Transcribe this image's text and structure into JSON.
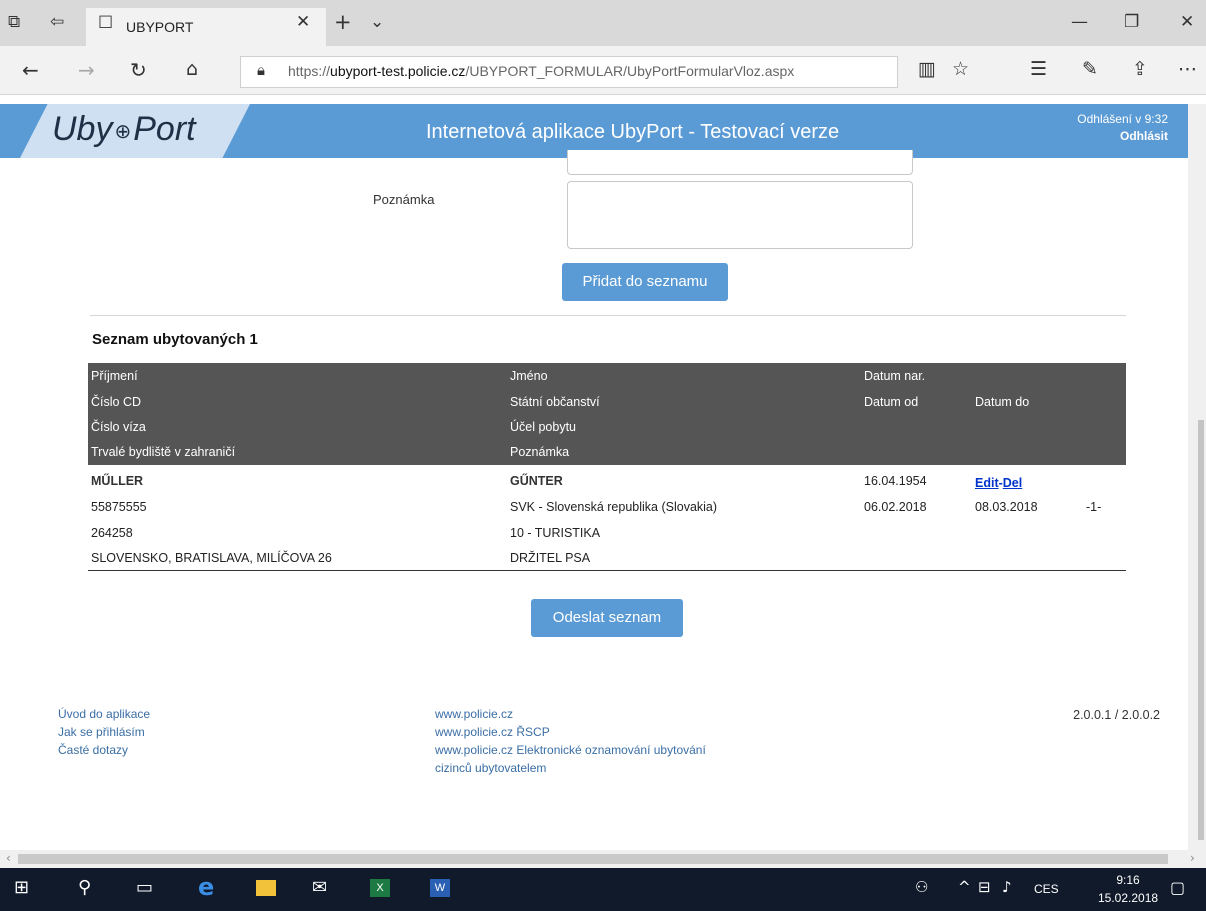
{
  "browser": {
    "tab_title": "UBYPORT",
    "url_prefix": "https://",
    "url_host": "ubyport-test.policie.cz",
    "url_path": "/UBYPORT_FORMULAR/UbyPortFormularVloz.aspx"
  },
  "header": {
    "logo_left": "Uby",
    "logo_right": "Port",
    "title": "Internetová aplikace UbyPort - Testovací verze",
    "logout_info": "Odhlášení v 9:32",
    "logout_link": "Odhlásit"
  },
  "form": {
    "note_label": "Poznámka",
    "note_value": "",
    "add_button": "Přidat do seznamu"
  },
  "list": {
    "title": "Seznam ubytovaných 1",
    "headers": {
      "col1": [
        "Příjmení",
        "Číslo CD",
        "Číslo víza",
        "Trvalé bydliště v zahraničí"
      ],
      "col2": [
        "Jméno",
        "Státní občanství",
        "Účel pobytu",
        "Poznámka"
      ],
      "col3": [
        "Datum nar.",
        "Datum od"
      ],
      "col4": [
        "Datum do"
      ]
    },
    "row": {
      "surname": "MŰLLER",
      "cd_number": "55875555",
      "visa_number": "264258",
      "address": "SLOVENSKO, BRATISLAVA, MILÍČOVA 26",
      "name": "GŰNTER",
      "citizenship": "SVK - Slovenská republika (Slovakia)",
      "purpose": "10 - TURISTIKA",
      "note": "DRŽITEL PSA",
      "birth_date": "16.04.1954",
      "date_from": "06.02.2018",
      "date_to": "08.03.2018",
      "edit": "Edit",
      "separator": "-",
      "del": "Del",
      "index": "-1-"
    },
    "send_button": "Odeslat seznam"
  },
  "footer": {
    "left_links": [
      "Úvod do aplikace",
      "Jak se přihlásím",
      "Časté dotazy"
    ],
    "mid_links": [
      "www.policie.cz",
      "www.policie.cz ŘSCP",
      "www.policie.cz Elektronické oznamování ubytování",
      "cizinců ubytovatelem"
    ],
    "version": "2.0.0.1 / 2.0.0.2"
  },
  "taskbar": {
    "language": "CES",
    "time": "9:16",
    "date": "15.02.2018"
  },
  "icons": {
    "browser": [
      "tab-preview-icon",
      "set-aside-tabs-icon",
      "tab-page-icon",
      "close-tab-icon",
      "new-tab-icon",
      "tab-dropdown-icon",
      "minimize-icon",
      "restore-icon",
      "close-window-icon",
      "back-icon",
      "forward-icon",
      "refresh-icon",
      "home-icon",
      "lock-icon",
      "reading-view-icon",
      "favorite-icon",
      "favorites-hub-icon",
      "pen-icon",
      "share-icon",
      "more-icon"
    ],
    "taskbar": [
      "windows-start-icon",
      "search-icon",
      "task-view-icon",
      "edge-icon",
      "file-explorer-icon",
      "mail-icon",
      "excel-icon",
      "word-icon",
      "people-icon",
      "tray-chevron-icon",
      "network-icon",
      "volume-icon",
      "notification-icon"
    ]
  },
  "colors": {
    "brand_blue": "#5b9bd5",
    "table_header": "#555555",
    "link_blue": "#0033cc",
    "taskbar": "#101a2a"
  }
}
